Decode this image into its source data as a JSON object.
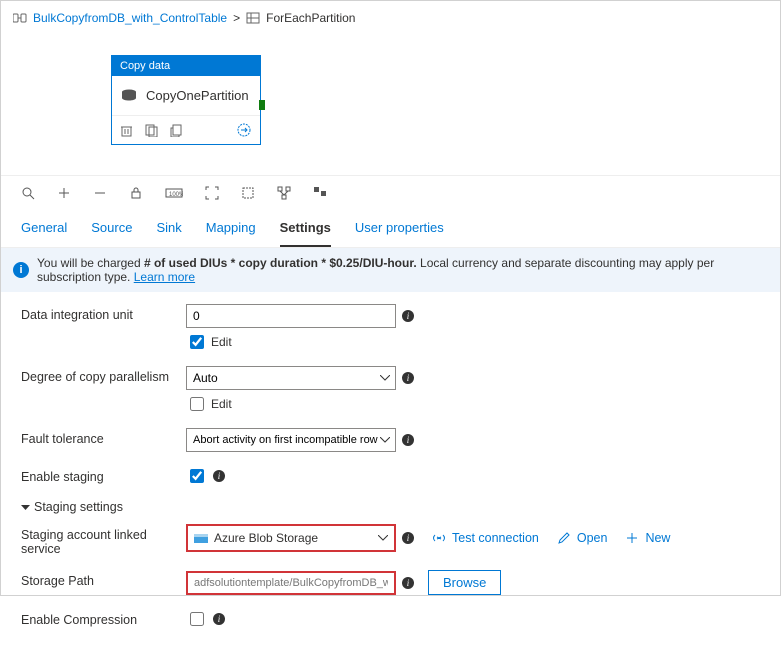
{
  "breadcrumb": {
    "root": "BulkCopyfromDB_with_ControlTable",
    "current": "ForEachPartition"
  },
  "activity": {
    "header": "Copy data",
    "name": "CopyOnePartition"
  },
  "tabs": {
    "general": "General",
    "source": "Source",
    "sink": "Sink",
    "mapping": "Mapping",
    "settings": "Settings",
    "user_properties": "User properties"
  },
  "info": {
    "prefix": "You will be charged ",
    "bold": "# of used DIUs * copy duration * $0.25/DIU-hour.",
    "suffix": " Local currency and separate discounting may apply per subscription type. ",
    "link": "Learn more"
  },
  "labels": {
    "diu": "Data integration unit",
    "parallelism": "Degree of copy parallelism",
    "fault": "Fault tolerance",
    "staging": "Enable staging",
    "staging_settings": "Staging settings",
    "staging_account": "Staging account linked service",
    "storage_path": "Storage Path",
    "compression": "Enable Compression",
    "edit": "Edit"
  },
  "fields": {
    "diu_value": "0",
    "diu_edit_checked": true,
    "parallelism_value": "Auto",
    "parallelism_edit_checked": false,
    "fault_value": "Abort activity on first incompatible row",
    "staging_checked": true,
    "linked_service_value": "Azure Blob Storage",
    "storage_path_value": "adfsolutiontemplate/BulkCopyfromDB_with_Co",
    "compression_checked": false
  },
  "actions": {
    "test": "Test connection",
    "open": "Open",
    "new": "New",
    "browse": "Browse"
  }
}
